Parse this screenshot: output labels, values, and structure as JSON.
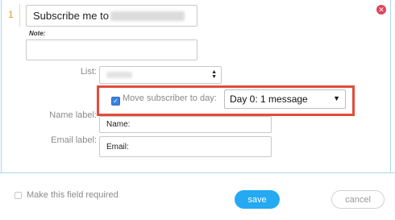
{
  "field": {
    "number": "1",
    "subject_value": "Subscribe me to",
    "note_label": "Note:",
    "note_value": ""
  },
  "list": {
    "label": "List:"
  },
  "move": {
    "checked": true,
    "label": "Move subscriber to day:",
    "selected_day": "Day 0: 1 message"
  },
  "name_field": {
    "label": "Name label:",
    "value": "Name:"
  },
  "email_field": {
    "label": "Email label:",
    "value": "Email:"
  },
  "required": {
    "checked": false,
    "label": "Make this field required"
  },
  "actions": {
    "save_label": "save",
    "cancel_label": "cancel"
  },
  "colors": {
    "accent": "#24a9f2",
    "highlight_border": "#e24c3a",
    "close": "#e0445a",
    "number": "#e39a2c"
  }
}
